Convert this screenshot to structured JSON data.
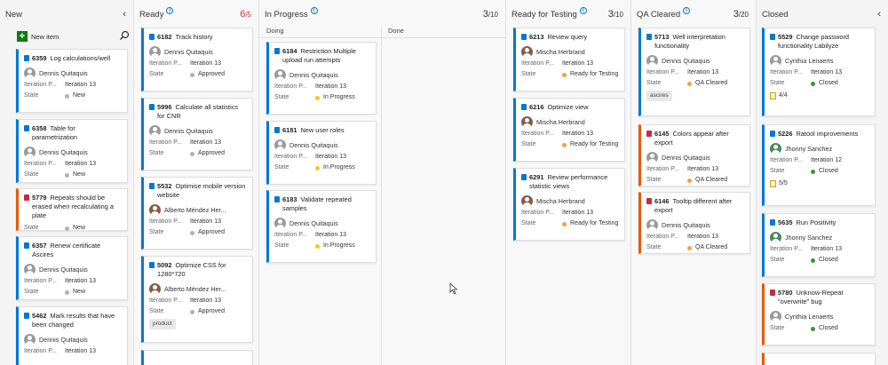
{
  "columns": {
    "new": {
      "title": "New"
    },
    "ready": {
      "title": "Ready",
      "wip_current": "6",
      "wip_limit": "/5"
    },
    "in_progress": {
      "title": "In Progress",
      "wip_current": "3",
      "wip_limit": "/10",
      "doing": "Doing",
      "done": "Done"
    },
    "ready_testing": {
      "title": "Ready for Testing",
      "wip_current": "3",
      "wip_limit": "/10"
    },
    "qa_cleared": {
      "title": "QA Cleared",
      "wip_current": "3",
      "wip_limit": "/20"
    },
    "closed": {
      "title": "Closed"
    }
  },
  "new_item_label": "New item",
  "labels": {
    "iteration_path": "Iteration P...",
    "state": "State"
  },
  "state_colors": {
    "New": "#b2b2b2",
    "Approved": "#b2b2b2",
    "In Progress": "#f2cb1d",
    "Ready for Testing": "#f2a33a",
    "QA Cleared": "#f2a33a",
    "Closed": "#339933"
  },
  "cards": {
    "c6359": {
      "id": "6359",
      "title": "Log calculations/well",
      "assignee": "Dennis Quitaquis",
      "iteration": "Iteration 13",
      "state": "New"
    },
    "c6358": {
      "id": "6358",
      "title": "Table for parametrization",
      "assignee": "Dennis Quitaquis",
      "iteration": "Iteration 13",
      "state": "New"
    },
    "c5779": {
      "id": "5779",
      "title": "Repeats should be erased when recalculating a plate",
      "state": "New"
    },
    "c6357": {
      "id": "6357",
      "title": "Renew certificate Ascires",
      "assignee": "Dennis Quitaquis",
      "iteration": "Iteration 13",
      "state": "New"
    },
    "c5462": {
      "id": "5462",
      "title": "Mark results that have been changed",
      "assignee": "Dennis Quitaquis",
      "iteration": "Iteration 13"
    },
    "c6182": {
      "id": "6182",
      "title": "Track history",
      "assignee": "Dennis Quitaquis",
      "iteration": "Iteration 13",
      "state": "Approved"
    },
    "c5996": {
      "id": "5996",
      "title": "Calculate all statistics for CNR",
      "assignee": "Dennis Quitaquis",
      "iteration": "Iteration 13",
      "state": "Approved"
    },
    "c5532": {
      "id": "5532",
      "title": "Optimise mobile version website",
      "assignee": "Alberto Méndez Her...",
      "iteration": "Iteration 13",
      "state": "Approved"
    },
    "c5092": {
      "id": "5092",
      "title": "Optimize CSS for 1280*720",
      "assignee": "Alberto Méndez Her...",
      "iteration": "Iteration 13",
      "state": "Approved",
      "tag": "product"
    },
    "c6184": {
      "id": "6184",
      "title": "Restriction Multiple upload run attempts",
      "assignee": "Dennis Quitaquis",
      "iteration": "Iteration 13",
      "state": "In Progress"
    },
    "c6181": {
      "id": "6181",
      "title": "New user roles",
      "assignee": "Dennis Quitaquis",
      "iteration": "Iteration 13",
      "state": "In Progress"
    },
    "c6183": {
      "id": "6183",
      "title": "Validate repeated samples",
      "assignee": "Dennis Quitaquis",
      "iteration": "Iteration 13",
      "state": "In Progress"
    },
    "c6213": {
      "id": "6213",
      "title": "Review query",
      "assignee": "Mischa Herbrand",
      "iteration": "Iteration 13",
      "state": "Ready for Testing"
    },
    "c6216": {
      "id": "6216",
      "title": "Optimize view",
      "assignee": "Mischa Herbrand",
      "iteration": "Iteration 13",
      "state": "Ready for Testing"
    },
    "c6291": {
      "id": "6291",
      "title": "Review performance statistic views",
      "assignee": "Mischa Herbrand",
      "iteration": "Iteration 13",
      "state": "Ready for Testing"
    },
    "c5713": {
      "id": "5713",
      "title": "Well interpretation functionality",
      "assignee": "Dennis Quitaquis",
      "iteration": "Iteration 13",
      "state": "QA Cleared",
      "tag": "ascires"
    },
    "c6145": {
      "id": "6145",
      "title": "Colors appear after export",
      "assignee": "Dennis Quitaquis",
      "iteration": "Iteration 13",
      "state": "QA Cleared"
    },
    "c6146": {
      "id": "6146",
      "title": "Tooltip different after export",
      "assignee": "Dennis Quitaquis",
      "iteration": "Iteration 13",
      "state": "QA Cleared"
    },
    "c5529": {
      "id": "5529",
      "title": "Change password functionality Labilyze",
      "assignee": "Cynthia Lenaerts",
      "iteration": "Iteration 13",
      "state": "Closed",
      "tasks": "4/4"
    },
    "c5226": {
      "id": "5226",
      "title": "Ratool improvements",
      "assignee": "Jhonny Sanchez",
      "iteration": "Iteration 12",
      "state": "Closed",
      "tasks": "5/5"
    },
    "c5635": {
      "id": "5635",
      "title": "Run Positivity",
      "assignee": "Jhonny Sanchez",
      "iteration": "Iteration 13",
      "state": "Closed"
    },
    "c5780": {
      "id": "5780",
      "title": "Unknow-Repeat \"overwrite\" bug",
      "assignee": "Cynthia Lenaerts",
      "state": "Closed"
    }
  }
}
